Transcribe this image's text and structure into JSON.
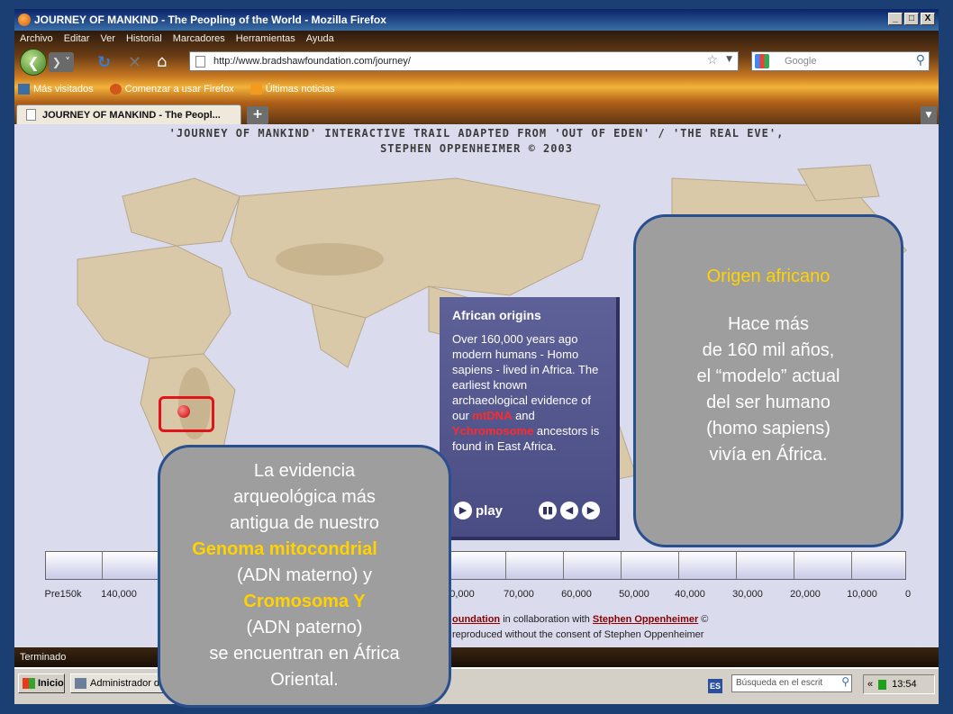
{
  "window": {
    "title": "JOURNEY OF MANKIND - The Peopling of the World - Mozilla Firefox",
    "buttons": {
      "minimize": "_",
      "maximize": "□",
      "close": "X"
    }
  },
  "menu": [
    "Archivo",
    "Editar",
    "Ver",
    "Historial",
    "Marcadores",
    "Herramientas",
    "Ayuda"
  ],
  "navigation": {
    "url": "http://www.bradshawfoundation.com/journey/",
    "search_placeholder": "Google"
  },
  "bookmarks": [
    {
      "label": "Más visitados",
      "icon": "bookmarks-folder-icon",
      "color": "#3a6ea5"
    },
    {
      "label": "Comenzar a usar Firefox",
      "icon": "firefox-icon",
      "color": "#d2561a"
    },
    {
      "label": "Últimas noticias",
      "icon": "rss-feed-icon",
      "color": "#f29b1d"
    }
  ],
  "tab": {
    "label": "JOURNEY OF MANKIND - The Peopl...",
    "new_tab": "+"
  },
  "page": {
    "heading_line1": "'JOURNEY OF MANKIND' INTERACTIVE TRAIL ADAPTED FROM 'OUT OF EDEN' / 'THE REAL EVE',",
    "heading_line2": "STEPHEN OPPENHEIMER © 2003",
    "panel": {
      "title": "African origins",
      "text_before": "Over 160,000 years ago modern humans - Homo sapiens - lived in Africa. The earliest known archaeological evidence of our ",
      "mtdna": "mtDNA",
      "and": " and ",
      "ychromosome": "Ychromosome",
      "text_after": " ancestors is found in East Africa.",
      "play": "play"
    },
    "timeline_labels": [
      "Pre150k",
      "140,000",
      "0,000",
      "70,000",
      "60,000",
      "50,000",
      "40,000",
      "30,000",
      "20,000",
      "10,000",
      "0"
    ],
    "footer_link1": "oundation",
    "footer_mid": " in collaboration with ",
    "footer_link2": "Stephen Oppenheimer",
    "footer_end": " ©",
    "footer_line2": "reproduced without the consent of Stephen Oppenheimer"
  },
  "status": "Terminado",
  "taskbar": {
    "start": "Inicio",
    "item": "Administrador de",
    "lang": "ES",
    "search": "Búsqueda en el escrit",
    "tray_arrows": "«",
    "time": "13:54"
  },
  "callout_right": {
    "heading": "Origen africano",
    "lines": [
      "Hace más",
      "de 160 mil años,",
      "el “modelo” actual",
      "del ser humano",
      "(homo sapiens)",
      "vivía en África."
    ]
  },
  "callout_left": {
    "l1": "La evidencia",
    "l2": "arqueológica más",
    "l3": "antigua de nuestro",
    "l4": "Genoma mitocondrial",
    "l5": "(ADN materno) y",
    "l6": "Cromosoma Y",
    "l7": "(ADN paterno)",
    "l8": "se encuentran en África",
    "l9": "Oriental."
  },
  "colors": {
    "accent_yellow": "#ffd200",
    "callout_bg": "#9e9e9e",
    "marker_red": "#e0141a",
    "panel_bg": "#5e6098"
  }
}
